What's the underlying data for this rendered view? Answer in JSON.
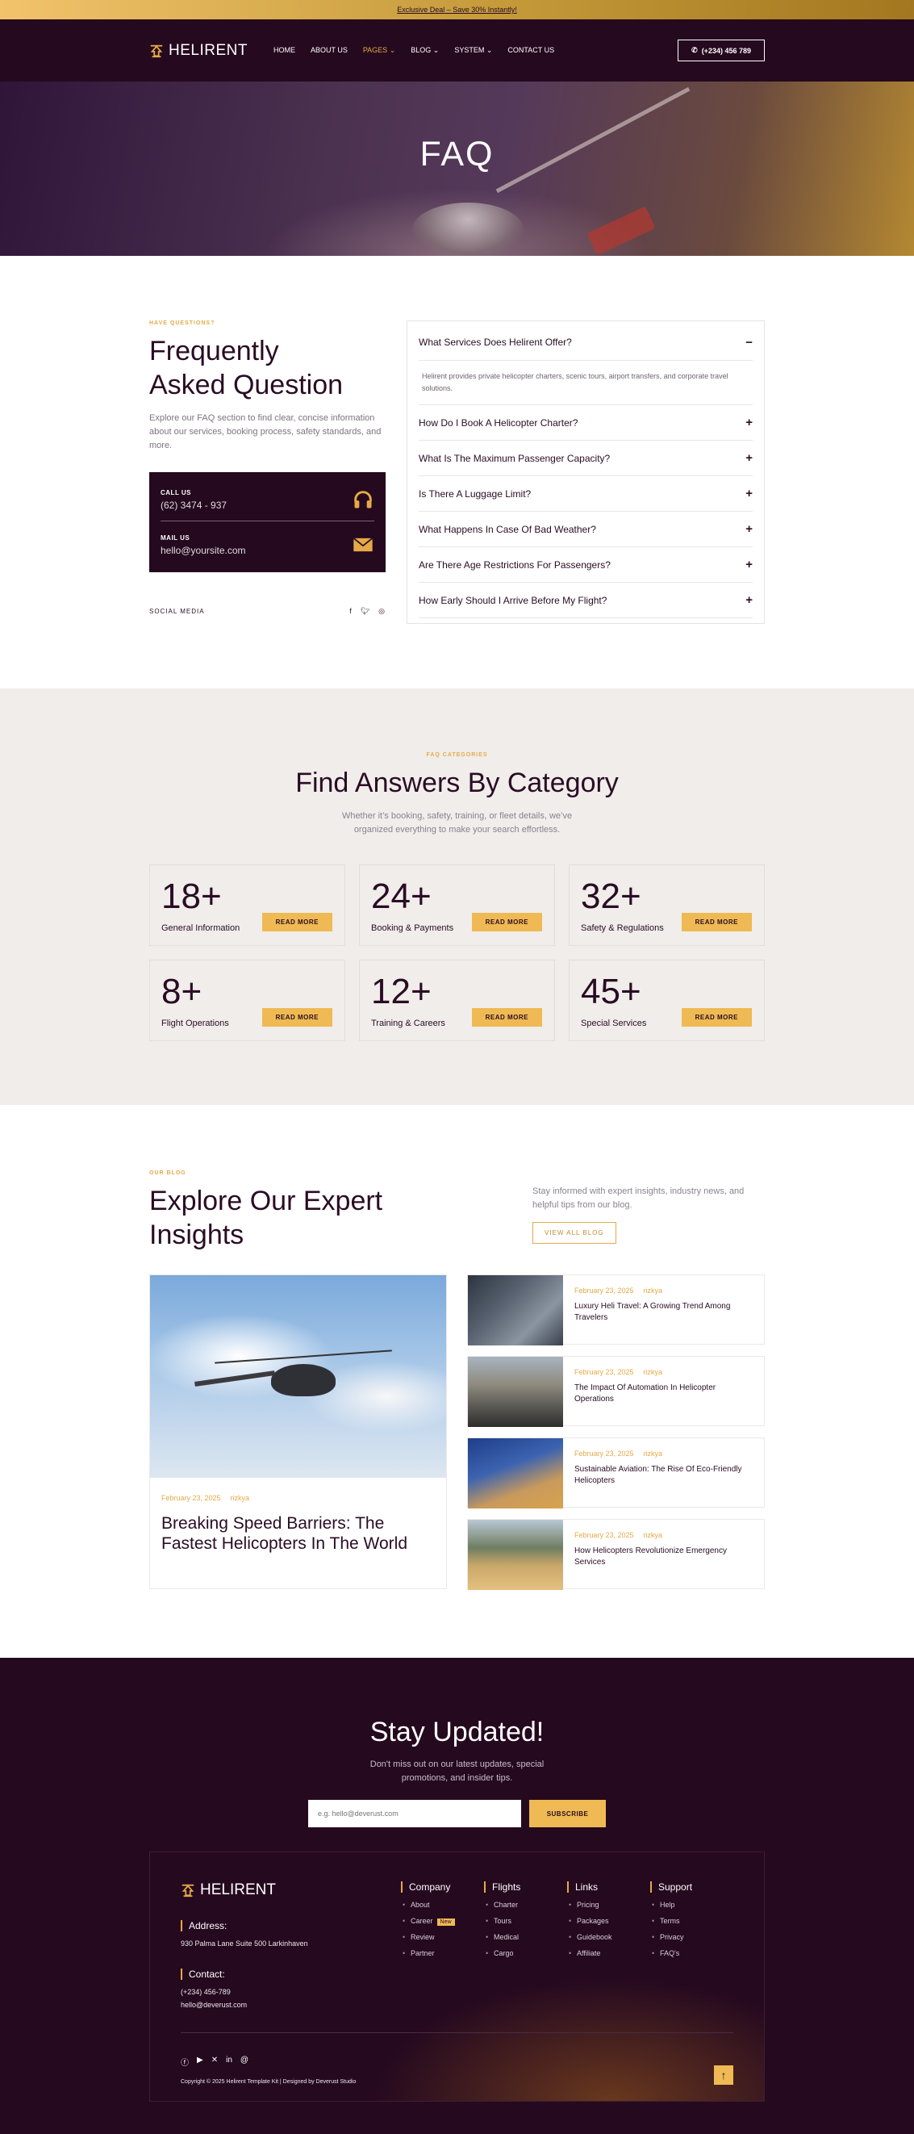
{
  "topbar": {
    "text": "Exclusive Deal – Save 30% Instantly!"
  },
  "nav": {
    "logo": "HELIRENT",
    "items": [
      {
        "label": "HOME"
      },
      {
        "label": "ABOUT US"
      },
      {
        "label": "PAGES",
        "active": true
      },
      {
        "label": "BLOG"
      },
      {
        "label": "SYSTEM"
      },
      {
        "label": "CONTACT US"
      }
    ],
    "phone": "(+234) 456 789"
  },
  "hero": {
    "title": "FAQ"
  },
  "faq": {
    "kicker": "HAVE QUESTIONS?",
    "title_line1": "Frequently",
    "title_line2": "Asked Question",
    "description": "Explore our FAQ section to find clear, concise information about our services, booking process, safety standards, and more.",
    "call_label": "CALL US",
    "call_value": "(62) 3474 - 937",
    "mail_label": "MAIL US",
    "mail_value": "hello@yoursite.com",
    "social_label": "SOCIAL MEDIA",
    "open_question": "What Services Does Helirent Offer?",
    "open_answer": "Helirent provides private helicopter charters, scenic tours, airport transfers, and corporate travel solutions.",
    "questions": [
      "How Do I Book A Helicopter Charter?",
      "What Is The Maximum Passenger Capacity?",
      "Is There A Luggage Limit?",
      "What Happens In Case Of Bad Weather?",
      "Are There Age Restrictions For Passengers?",
      "How Early Should I Arrive Before My Flight?"
    ]
  },
  "categories": {
    "kicker": "FAQ CATEGORIES",
    "title": "Find Answers By Category",
    "subtitle": "Whether it’s booking, safety, training, or fleet details, we’ve organized everything to make your search effortless.",
    "button": "READ MORE",
    "items": [
      {
        "num": "18+",
        "label": "General Information"
      },
      {
        "num": "24+",
        "label": "Booking & Payments"
      },
      {
        "num": "32+",
        "label": "Safety & Regulations"
      },
      {
        "num": "8+",
        "label": "Flight Operations"
      },
      {
        "num": "12+",
        "label": "Training & Careers"
      },
      {
        "num": "45+",
        "label": "Special Services"
      }
    ]
  },
  "blog": {
    "kicker": "OUR BLOG",
    "title": "Explore Our Expert Insights",
    "intro": "Stay informed with expert insights, industry news, and helpful tips from our blog.",
    "view_all": "VIEW ALL BLOG",
    "featured": {
      "date": "February 23, 2025",
      "author": "rizkya",
      "title": "Breaking Speed Barriers: The Fastest Helicopters In The World"
    },
    "posts": [
      {
        "date": "February 23, 2025",
        "author": "rizkya",
        "title": "Luxury Heli Travel: A Growing Trend Among Travelers"
      },
      {
        "date": "February 23, 2025",
        "author": "rizkya",
        "title": "The Impact Of Automation In Helicopter Operations"
      },
      {
        "date": "February 23, 2025",
        "author": "rizkya",
        "title": "Sustainable Aviation: The Rise Of Eco-Friendly Helicopters"
      },
      {
        "date": "February 23, 2025",
        "author": "rizkya",
        "title": "How Helicopters Revolutionize Emergency Services"
      }
    ]
  },
  "footer": {
    "title": "Stay Updated!",
    "subtitle": "Don't miss out on our latest updates, special promotions, and insider tips.",
    "input_placeholder": "e.g. hello@deverust.com",
    "subscribe": "SUBSCRIBE",
    "logo": "HELIRENT",
    "address_h": "Address:",
    "address": "930 Palma Lane Suite 500 Larkinhaven",
    "contact_h": "Contact:",
    "phone": "(+234) 456-789",
    "email": "hello@deverust.com",
    "new_badge": "New",
    "columns": [
      {
        "title": "Company",
        "links": [
          "About",
          "Career",
          "Review",
          "Partner"
        ]
      },
      {
        "title": "Flights",
        "links": [
          "Charter",
          "Tours",
          "Medical",
          "Cargo"
        ]
      },
      {
        "title": "Links",
        "links": [
          "Pricing",
          "Packages",
          "Guidebook",
          "Affiliate"
        ]
      },
      {
        "title": "Support",
        "links": [
          "Help",
          "Terms",
          "Privacy",
          "FAQ's"
        ]
      }
    ],
    "copyright": "Copyright © 2025 Helirent Template Kit | Designed by Deverust Studio",
    "up_icon": "arrow-up-icon"
  },
  "colors": {
    "dark": "#25091f",
    "accent": "#efba53",
    "light_bg": "#f0edea"
  }
}
